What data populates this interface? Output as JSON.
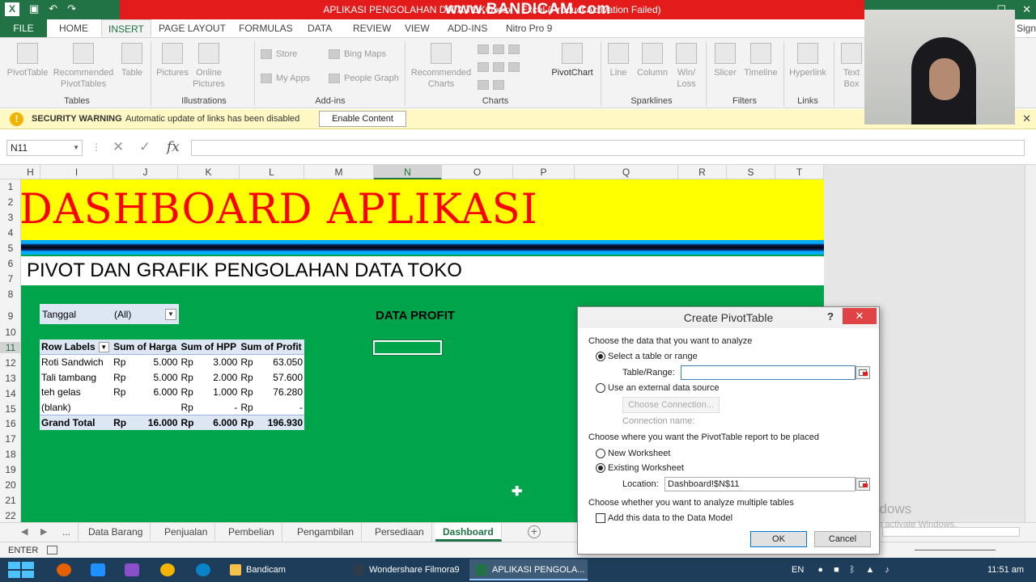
{
  "app": {
    "window_title": "APLIKASI PENGOLAHAN DATA TOKO.xlsx - Excel (Product Activation Failed)",
    "recorder_watermark": "www.BANDICAM.com",
    "sign_in": "Sign in"
  },
  "ribbon": {
    "file_tab": "FILE",
    "tabs": [
      "HOME",
      "INSERT",
      "PAGE LAYOUT",
      "FORMULAS",
      "DATA",
      "REVIEW",
      "VIEW",
      "ADD-INS",
      "Nitro Pro 9"
    ],
    "active_tab": "INSERT",
    "groups": {
      "tables": "Tables",
      "illustrations": "Illustrations",
      "addins": "Add-ins",
      "charts": "Charts",
      "sparklines": "Sparklines",
      "filters": "Filters",
      "links": "Links"
    },
    "buttons": {
      "pivottable": "PivotTable",
      "recommended_pivottables": "Recommended PivotTables",
      "table": "Table",
      "pictures": "Pictures",
      "online_pictures": "Online Pictures",
      "store": "Store",
      "my_apps": "My Apps",
      "bing_maps": "Bing Maps",
      "people_graph": "People Graph",
      "recommended_charts": "Recommended Charts",
      "pivotchart": "PivotChart",
      "line": "Line",
      "column": "Column",
      "win_loss": "Win/ Loss",
      "slicer": "Slicer",
      "timeline": "Timeline",
      "hyperlink": "Hyperlink",
      "text_box": "Text Box"
    }
  },
  "security": {
    "title": "SECURITY WARNING",
    "message": "Automatic update of links has been disabled",
    "button": "Enable Content"
  },
  "formula_bar": {
    "name_box": "N11",
    "fx": "fx",
    "content": ""
  },
  "grid": {
    "columns": [
      "H",
      "I",
      "J",
      "K",
      "L",
      "M",
      "N",
      "O",
      "P",
      "Q",
      "R",
      "S",
      "T"
    ],
    "selected_column": "N",
    "rows": [
      "1",
      "2",
      "3",
      "4",
      "5",
      "6",
      "7",
      "8",
      "9",
      "10",
      "11",
      "12",
      "13",
      "14",
      "15",
      "16",
      "17",
      "18",
      "19",
      "20",
      "21",
      "22"
    ],
    "selected_row": "11"
  },
  "sheet": {
    "title": "DASHBOARD APLIKASI",
    "subtitle": "PIVOT DAN GRAFIK PENGOLAHAN DATA TOKO",
    "profit_title": "DATA PROFIT",
    "filter": {
      "label": "Tanggal",
      "value": "(All)"
    },
    "pivot": {
      "headers": [
        "Row Labels",
        "Sum of Harga",
        "Sum of HPP",
        "Sum of Profit"
      ],
      "rows": [
        {
          "label": "Roti Sandwich",
          "cur1": "Rp",
          "harga": "5.000",
          "cur2": "Rp",
          "hpp": "3.000",
          "cur3": "Rp",
          "profit": "63.050"
        },
        {
          "label": "Tali tambang",
          "cur1": "Rp",
          "harga": "5.000",
          "cur2": "Rp",
          "hpp": "2.000",
          "cur3": "Rp",
          "profit": "57.600"
        },
        {
          "label": "teh gelas",
          "cur1": "Rp",
          "harga": "6.000",
          "cur2": "Rp",
          "hpp": "1.000",
          "cur3": "Rp",
          "profit": "76.280"
        },
        {
          "label": "(blank)",
          "cur1": "",
          "harga": "",
          "cur2": "Rp",
          "hpp": "-",
          "cur3": "Rp",
          "profit": "-"
        }
      ],
      "total": {
        "label": "Grand Total",
        "cur1": "Rp",
        "harga": "16.000",
        "cur2": "Rp",
        "hpp": "6.000",
        "cur3": "Rp",
        "profit": "196.930"
      }
    }
  },
  "sheet_tabs": {
    "ellipsis": "...",
    "tabs": [
      "Data Barang",
      "Penjualan",
      "Pembelian",
      "Pengambilan",
      "Persediaan",
      "Dashboard"
    ],
    "active": "Dashboard"
  },
  "status": {
    "mode": "ENTER"
  },
  "dialog": {
    "title": "Create PivotTable",
    "help": "?",
    "section1": "Choose the data that you want to analyze",
    "opt_select_range": "Select a table or range",
    "table_range_label": "Table/Range:",
    "table_range_value": "",
    "opt_external": "Use an external data source",
    "choose_connection": "Choose Connection...",
    "connection_name_label": "Connection name:",
    "section2": "Choose where you want the PivotTable report to be placed",
    "opt_new_ws": "New Worksheet",
    "opt_existing_ws": "Existing Worksheet",
    "location_label": "Location:",
    "location_value": "Dashboard!$N$11",
    "section3": "Choose whether you want to analyze multiple tables",
    "data_model": "Add this data to the Data Model",
    "ok": "OK",
    "cancel": "Cancel"
  },
  "watermark": {
    "line1": "Activate Windows",
    "line2": "Go to PC settings to activate Windows."
  },
  "taskbar": {
    "apps": [
      "Bandicam",
      "Wondershare Filmora9",
      "APLIKASI PENGOLA..."
    ],
    "language": "EN",
    "time": "11:51 am"
  }
}
